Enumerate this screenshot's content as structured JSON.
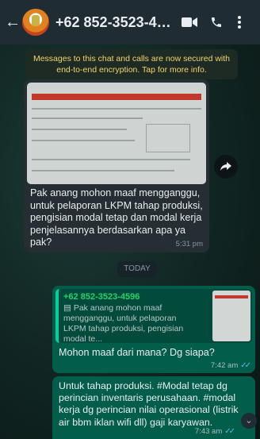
{
  "header": {
    "contact_name": "+62 852-3523-45...",
    "back_icon": "arrow-back-icon",
    "video_icon": "video-call-icon",
    "call_icon": "phone-call-icon",
    "menu_icon": "more-vert-icon"
  },
  "notice": {
    "text": "Messages to this chat and calls are now secured with end-to-end encryption. Tap for more info."
  },
  "incoming": {
    "text": "Pak anang mohon maaf mengganggu, untuk pelaporan LKPM tahap produksi, pengisian modal tetap dan modal kerja penjelasannya berdasarkan apa ya pak?",
    "time": "5:31 pm"
  },
  "date_chip": {
    "label": "TODAY"
  },
  "reply": {
    "quote_author": "+62 852-3523-4596",
    "quote_text": "Pak anang mohon maaf mengganggu, untuk pelaporan LKPM tahap produksi, pengisian modal te...",
    "text": "Mohon maaf dari mana? Dg siapa?",
    "time": "7:42 am"
  },
  "message2": {
    "text": "Untuk tahap produksi. #Modal tetap dg perincian inventaris perusahaan. #modal kerja dg perincian nilai operasional (listrik air bbm iklan wifi dll) gaji karyawan.",
    "time": "7:43 am"
  },
  "colors": {
    "header": "#1f2c34",
    "outgoing_bubble": "#035d4b",
    "incoming_bubble": "#252e33",
    "notice_text": "#f3d36b",
    "read_ticks": "#53bdeb"
  }
}
